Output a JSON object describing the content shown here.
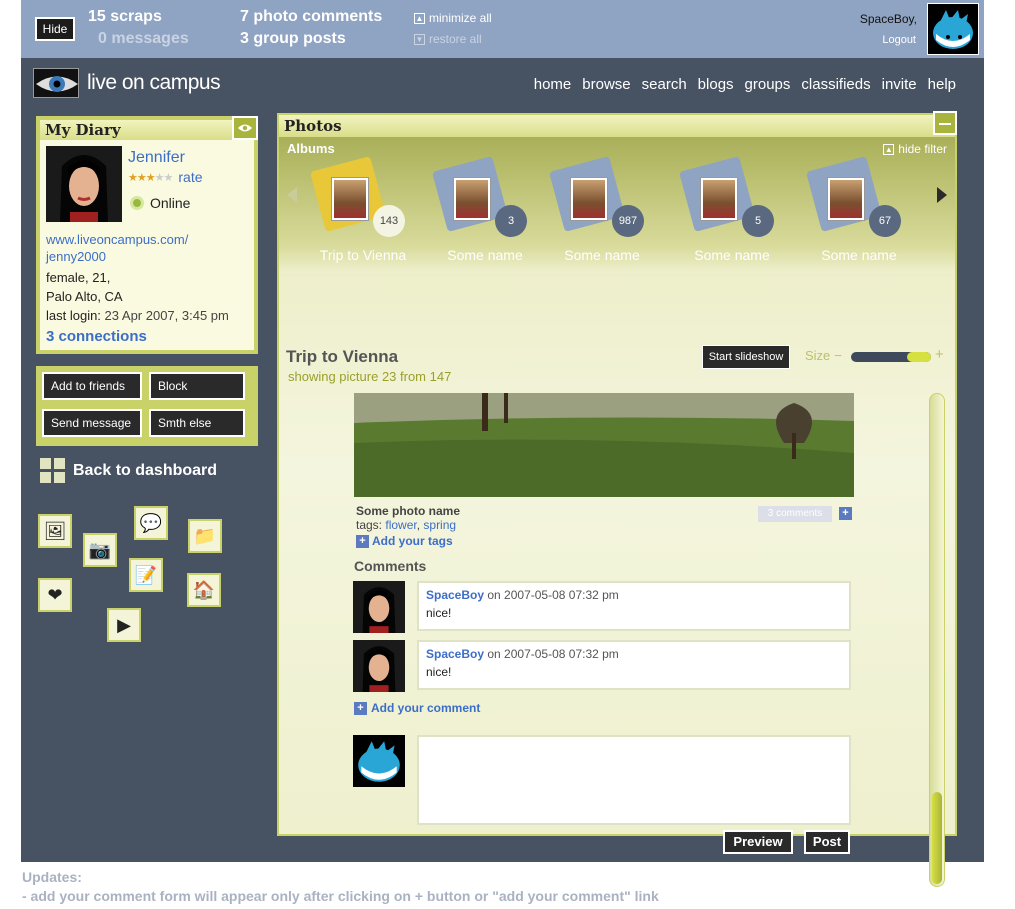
{
  "topbar": {
    "hide_label": "Hide",
    "scraps": "15 scraps",
    "messages": "0 messages",
    "photo_comments": "7 photo comments",
    "group_posts": "3 group posts",
    "minimize_all": "minimize all",
    "restore_all": "restore all",
    "user": "SpaceBoy,",
    "logout": "Logout"
  },
  "logo": {
    "text": "live on campus"
  },
  "nav": [
    "home",
    "browse",
    "search",
    "blogs",
    "groups",
    "classifieds",
    "invite",
    "help"
  ],
  "diary": {
    "title": "My Diary",
    "name": "Jennifer",
    "rate": "rate",
    "status": "Online",
    "url1": "www.liveoncampus.com/",
    "url2": "jenny2000",
    "info1": "female, 21,",
    "info2": "Palo Alto, CA",
    "last_login_label": "last login:",
    "last_login": "23 Apr 2007, 3:45 pm",
    "connections": "3 connections",
    "stars_filled": 3,
    "stars_total": 5
  },
  "actions": {
    "add_friends": "Add to friends",
    "block": "Block",
    "send_message": "Send message",
    "smth_else": "Smth else"
  },
  "back_dashboard": "Back to dashboard",
  "photos": {
    "title": "Photos",
    "albums_label": "Albums",
    "hide_filter": "hide filter",
    "albums": [
      {
        "name": "Trip to Vienna",
        "count": "143"
      },
      {
        "name": "Some name",
        "count": "3"
      },
      {
        "name": "Some name",
        "count": "987"
      },
      {
        "name": "Some name",
        "count": "5"
      },
      {
        "name": "Some name",
        "count": "67"
      }
    ],
    "album_title": "Trip to Vienna",
    "showing": "showing picture 23 from 147",
    "slideshow": "Start slideshow",
    "size_label": "Size",
    "photo_name": "Some photo name",
    "tags_label": "tags:",
    "tag1": "flower",
    "tag2": "spring",
    "add_tags": "Add your tags",
    "comments_badge": "3 comments",
    "comments_title": "Comments",
    "comments": [
      {
        "user": "SpaceBoy",
        "date": "on 2007-05-08 07:32 pm",
        "text": "nice!"
      },
      {
        "user": "SpaceBoy",
        "date": "on 2007-05-08 07:32 pm",
        "text": "nice!"
      }
    ],
    "add_comment": "Add your comment",
    "preview": "Preview",
    "post": "Post"
  },
  "colors": {
    "accent": "#c8d268",
    "dark": "#475262",
    "topbar": "#8fa3c2",
    "link": "#3c6ec8"
  },
  "updates": {
    "line1": "Updates:",
    "line2": "- add your comment form will appear only after clicking on + button or \"add your comment\" link"
  }
}
